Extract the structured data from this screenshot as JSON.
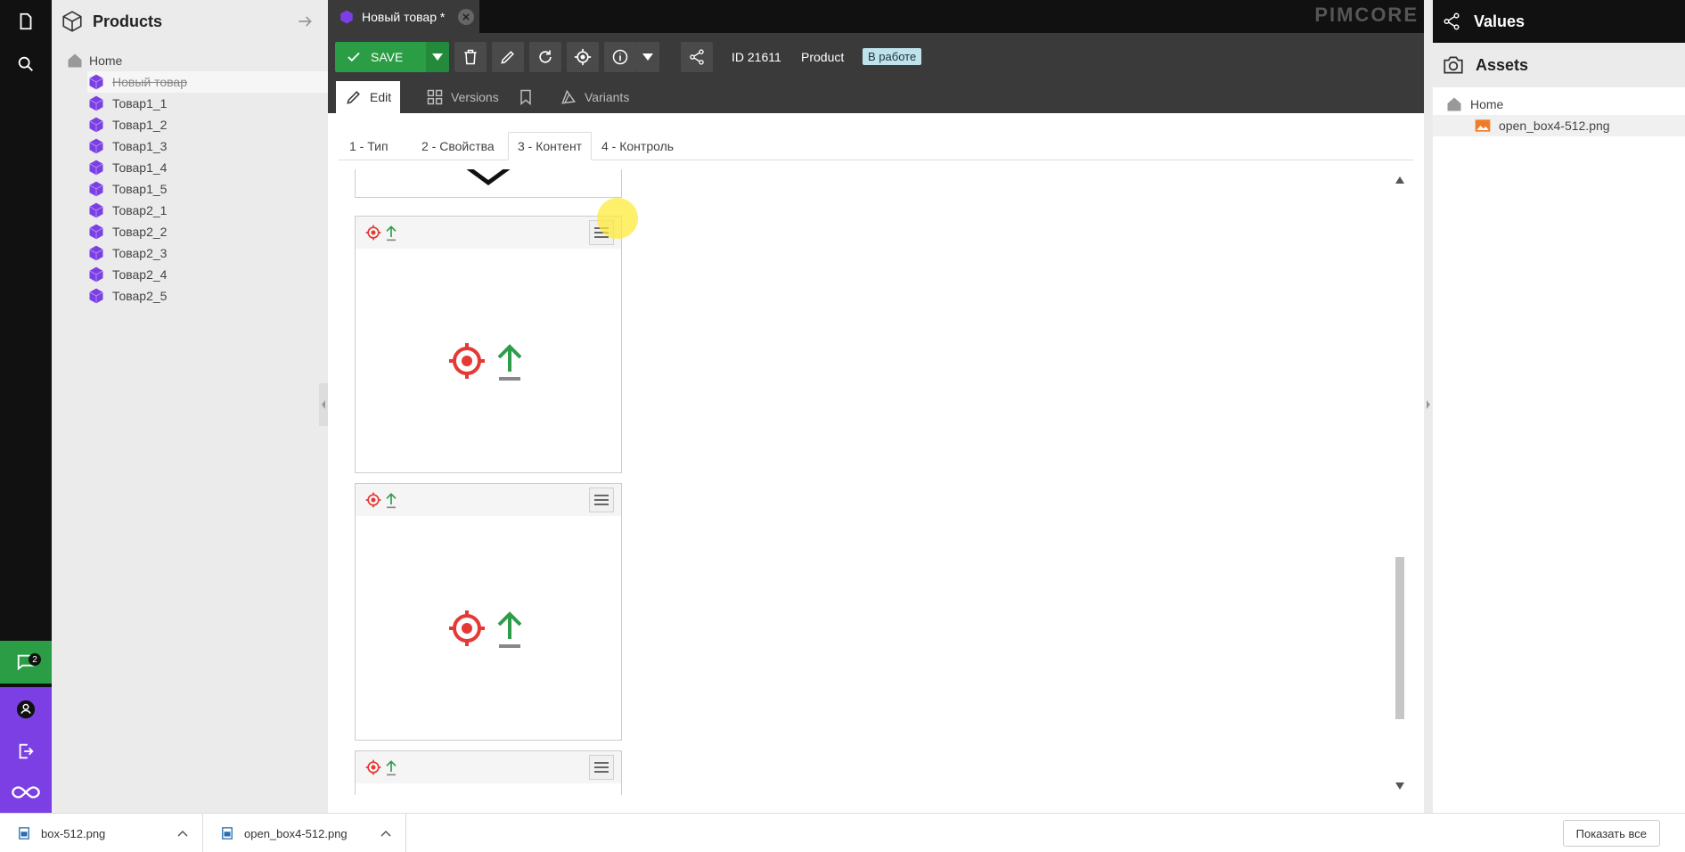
{
  "left_panel": {
    "title": "Products",
    "tree": [
      {
        "label": "Home",
        "icon": "home-icon"
      },
      {
        "label": "Новый товар",
        "icon": "cube-icon",
        "selected": true,
        "strikethrough": true
      },
      {
        "label": "Товар1_1",
        "icon": "cube-icon"
      },
      {
        "label": "Товар1_2",
        "icon": "cube-icon"
      },
      {
        "label": "Товар1_3",
        "icon": "cube-icon"
      },
      {
        "label": "Товар1_4",
        "icon": "cube-icon"
      },
      {
        "label": "Товар1_5",
        "icon": "cube-icon"
      },
      {
        "label": "Товар2_1",
        "icon": "cube-icon"
      },
      {
        "label": "Товар2_2",
        "icon": "cube-icon"
      },
      {
        "label": "Товар2_3",
        "icon": "cube-icon"
      },
      {
        "label": "Товар2_4",
        "icon": "cube-icon"
      },
      {
        "label": "Товар2_5",
        "icon": "cube-icon"
      }
    ]
  },
  "rail": {
    "chat_badge": "2"
  },
  "tab": {
    "title": "Новый товар *"
  },
  "brand": "PIMCORE",
  "toolbar": {
    "save_label": "SAVE",
    "id_label": "ID 21611",
    "class_label": "Product",
    "status": "В работе"
  },
  "subtabs": [
    "Edit",
    "Versions",
    "Variants"
  ],
  "steps": [
    "1 - Тип",
    "2 - Свойства",
    "3 - Контент",
    "4 - Контроль"
  ],
  "right_panel": {
    "values_title": "Values",
    "assets_title": "Assets",
    "assets_home": "Home",
    "asset_file": "open_box4-512.png"
  },
  "downloads": [
    {
      "name": "box-512.png"
    },
    {
      "name": "open_box4-512.png"
    }
  ],
  "show_all": "Показать все",
  "colors": {
    "accent_green": "#2a9d45",
    "purple": "#7b3fe4",
    "target_red": "#e53935",
    "upload_green": "#2e9d4a"
  }
}
